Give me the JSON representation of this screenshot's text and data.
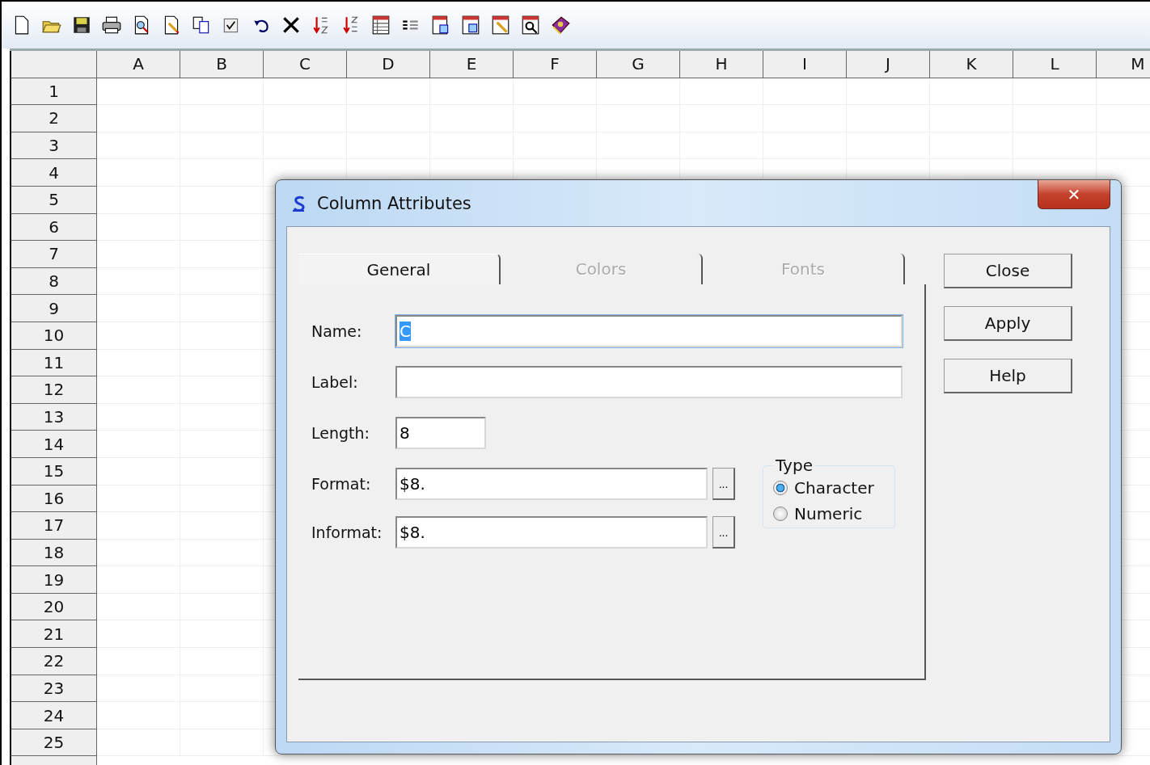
{
  "spreadsheet": {
    "columns": [
      "A",
      "B",
      "C",
      "D",
      "E",
      "F",
      "G",
      "H",
      "I",
      "J",
      "K",
      "L",
      "M"
    ],
    "rows": [
      "1",
      "2",
      "3",
      "4",
      "5",
      "6",
      "7",
      "8",
      "9",
      "10",
      "11",
      "12",
      "13",
      "14",
      "15",
      "16",
      "17",
      "18",
      "19",
      "20",
      "21",
      "22",
      "23",
      "24",
      "25"
    ]
  },
  "dialog": {
    "title": "Column Attributes",
    "close_glyph": "✕",
    "tabs": [
      {
        "label": "General",
        "selected": true,
        "disabled": false
      },
      {
        "label": "Colors",
        "selected": false,
        "disabled": true
      },
      {
        "label": "Fonts",
        "selected": false,
        "disabled": true
      }
    ],
    "fields": [
      {
        "kind": "text",
        "label": "Name:",
        "value": "C",
        "highlighted": true,
        "focused": true
      },
      {
        "kind": "text",
        "label": "Label:",
        "focused": false
      },
      {
        "kind": "short",
        "label": "Length:",
        "value": "8",
        "focused": false
      },
      {
        "kind": "browse",
        "label": "Format:",
        "value": "$8.",
        "browse": "...",
        "focused": false
      },
      {
        "kind": "browse",
        "label": "Informat:",
        "value": "$8.",
        "browse": "...",
        "focused": false
      }
    ],
    "type_group": {
      "title": "Type",
      "options": [
        {
          "label": "Character",
          "selected": true
        },
        {
          "label": "Numeric",
          "selected": false
        }
      ]
    },
    "buttons": [
      "Close",
      "Apply",
      "Help"
    ]
  }
}
